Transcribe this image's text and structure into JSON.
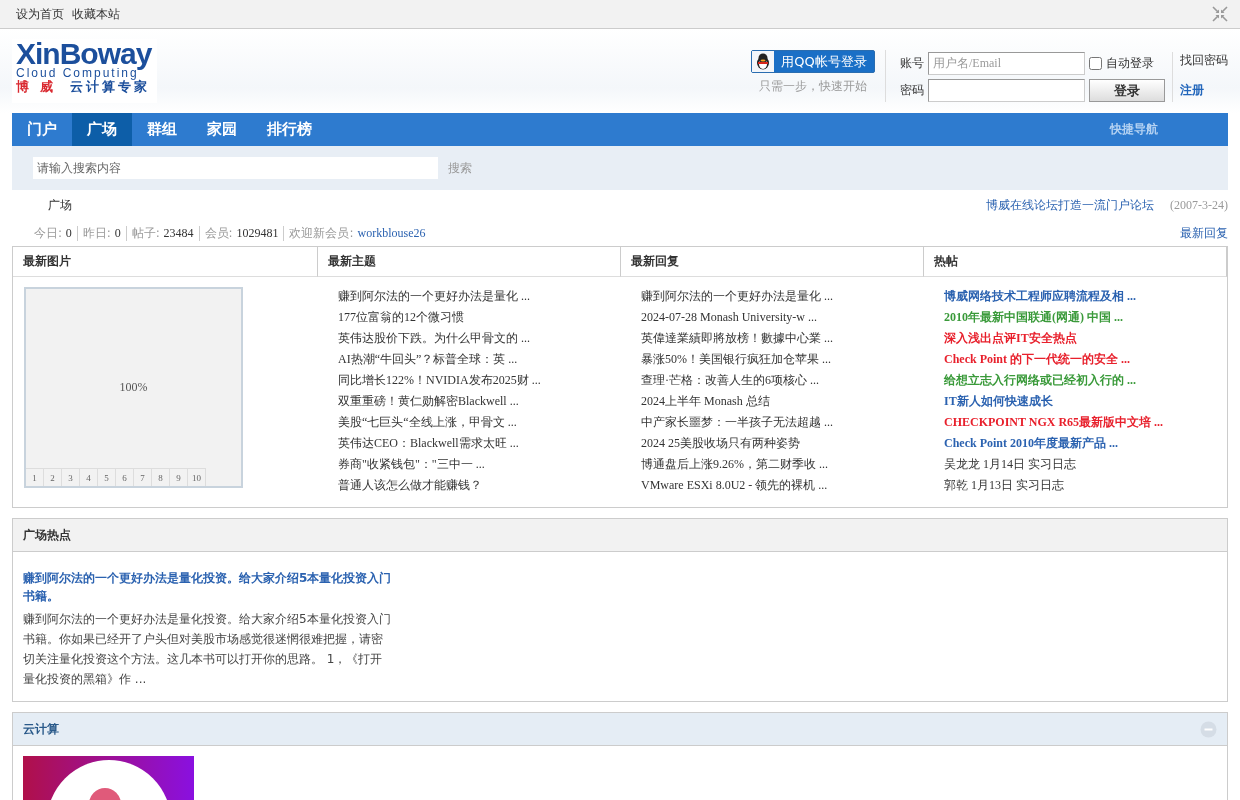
{
  "top_links": [
    "设为首页",
    "收藏本站"
  ],
  "logo": {
    "name": "XinBoway",
    "subtitle": "Cloud Computing",
    "brand_cn": "博 威",
    "slogan": "云计算专家"
  },
  "qq_login": {
    "label": "用QQ帐号登录",
    "hint": "只需一步，快速开始"
  },
  "login": {
    "account": {
      "label": "账号",
      "placeholder": "用户名/Email"
    },
    "password": {
      "label": "密码"
    },
    "auto_login": {
      "label": "自动登录",
      "checked": false
    },
    "submit": "登录",
    "forgot": "找回密码",
    "register": "注册"
  },
  "nav": {
    "tabs": [
      {
        "label": "门户",
        "selected": false
      },
      {
        "label": "广场",
        "selected": true
      },
      {
        "label": "群组",
        "selected": false
      },
      {
        "label": "家园",
        "selected": false
      },
      {
        "label": "排行榜",
        "selected": false
      }
    ],
    "quick_nav": "快捷导航"
  },
  "search": {
    "placeholder": "请输入搜索内容",
    "button": "搜索"
  },
  "breadcrumb": "广场",
  "announcement": {
    "title": "博威在线论坛打造一流门户论坛",
    "date": "(2007-3-24)"
  },
  "stats": [
    {
      "label": "今日:",
      "value": "0"
    },
    {
      "label": "昨日:",
      "value": "0"
    },
    {
      "label": "帖子:",
      "value": "23484"
    },
    {
      "label": "会员:",
      "value": "1029481"
    }
  ],
  "new_member": {
    "label": "欢迎新会员:",
    "user": "workblouse26"
  },
  "latest_replies_link": "最新回复",
  "portal": {
    "columns": [
      "最新图片",
      "最新主题",
      "最新回复",
      "热帖"
    ],
    "slideshow": {
      "caption": "100%",
      "pages": [
        {
          "label": "1",
          "selected": false
        },
        {
          "label": "2",
          "selected": false
        },
        {
          "label": "3",
          "selected": false
        },
        {
          "label": "4",
          "selected": false
        },
        {
          "label": "5",
          "selected": false
        },
        {
          "label": "6",
          "selected": false
        },
        {
          "label": "7",
          "selected": false
        },
        {
          "label": "8",
          "selected": false
        },
        {
          "label": "9",
          "selected": false
        },
        {
          "label": "10",
          "selected": false
        }
      ]
    },
    "latest_topics": [
      "赚到阿尔法的一个更好办法是量化 ...",
      "177位富翁的12个微习惯",
      "英伟达股价下跌。为什么甲骨文的 ...",
      "AI热潮“牛回头”？标普全球：英 ...",
      "同比增长122%！NVIDIA发布2025财 ...",
      "双重重磅！黄仁勋解密Blackwell ...",
      "美股“七巨头“全线上涨，甲骨文 ...",
      "英伟达CEO：Blackwell需求太旺 ...",
      "券商\"收紧钱包\"：\"三中一 ...",
      "普通人该怎么做才能赚钱？"
    ],
    "latest_replies": [
      "赚到阿尔法的一个更好办法是量化 ...",
      "2024-07-28 Monash University-w ...",
      "英偉達業績即將放榜！數據中心業 ...",
      "暴涨50%！美国银行疯狂加仓苹果 ...",
      "查理·芒格：改善人生的6项核心 ...",
      "2024上半年 Monash 总结",
      "中产家长噩梦：一半孩子无法超越 ...",
      "2024 25美股收场只有两种姿势",
      "博通盘后上涨9.26%，第二财季收 ...",
      "VMware ESXi 8.0U2 - 领先的裸机 ..."
    ],
    "hot_posts": [
      {
        "title": "博威网络技术工程师应聘流程及相 ...",
        "kind": "highlight",
        "color": "#2b62b0"
      },
      {
        "title": "2010年最新中国联通(网通) 中国 ...",
        "kind": "highlight",
        "color": "#3a9a3a"
      },
      {
        "title": "深入浅出点评IT安全热点",
        "kind": "highlight",
        "color": "#e8202c"
      },
      {
        "title": "Check Point 的下一代统一的安全 ...",
        "kind": "highlight",
        "color": "#e8202c"
      },
      {
        "title": "给想立志入行网络或已经初入行的 ...",
        "kind": "highlight",
        "color": "#3a9a3a"
      },
      {
        "title": "IT新人如何快速成长",
        "kind": "highlight",
        "color": "#2b62b0"
      },
      {
        "title": "CHECKPOINT NGX R65最新版中文培 ...",
        "kind": "highlight",
        "color": "#e8202c"
      },
      {
        "title": "Check Point 2010年度最新产品 ...",
        "kind": "highlight",
        "color": "#2b62b0"
      },
      {
        "title": "吴龙龙 1月14日 实习日志",
        "kind": "plain"
      },
      {
        "title": "郭乾 1月13日 实习日志",
        "kind": "plain"
      }
    ]
  },
  "square_hot": {
    "title": "广场热点",
    "post": {
      "title": "赚到阿尔法的一个更好办法是量化投资。给大家介绍5本量化投资入门书籍。",
      "excerpt": "赚到阿尔法的一个更好办法是量化投资。给大家介绍5本量化投资入门书籍。你如果已经开了户头但对美股市场感觉很迷惘很难把握，请密切关注量化投资这个方法。这几本书可以打开你的思路。 1，《打开量化投资的黑箱》作 ..."
    }
  },
  "cloud": {
    "title": "云计算",
    "expanded": true
  }
}
